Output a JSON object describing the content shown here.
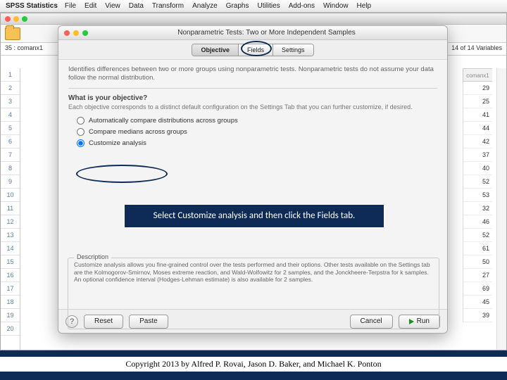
{
  "menubar": {
    "app": "SPSS Statistics",
    "items": [
      "File",
      "Edit",
      "View",
      "Data",
      "Transform",
      "Analyze",
      "Graphs",
      "Utilities",
      "Add-ons",
      "Window",
      "Help"
    ]
  },
  "datawin": {
    "cellref": "35 : comanx1",
    "varcount": "14 of 14 Variables",
    "colname": "comanx1",
    "rows": [
      "1",
      "2",
      "3",
      "4",
      "5",
      "6",
      "7",
      "8",
      "9",
      "10",
      "11",
      "12",
      "13",
      "14",
      "15",
      "16",
      "17",
      "18",
      "19",
      "20"
    ],
    "vals": [
      "29",
      "25",
      "41",
      "44",
      "42",
      "37",
      "40",
      "52",
      "53",
      "32",
      "46",
      "52",
      "61",
      "50",
      "27",
      "69",
      "45",
      "39",
      "",
      ""
    ]
  },
  "dialog": {
    "title": "Nonparametric Tests: Two or More Independent Samples",
    "tabs": {
      "objective": "Objective",
      "fields": "Fields",
      "settings": "Settings"
    },
    "intro": "Identifies differences between two or more groups using nonparametric tests. Nonparametric tests do not assume your data follow the normal distribution.",
    "qhead": "What is your objective?",
    "qsub": "Each objective corresponds to a distinct default configuration on the Settings Tab that you can further customize, if desired.",
    "opt1": "Automatically compare distributions across groups",
    "opt2": "Compare medians across groups",
    "opt3": "Customize analysis",
    "desc_legend": "Description",
    "desc_text": "Customize analysis allows you fine-grained control over the tests performed and their options. Other tests available on the Settings tab are the Kolmogorov-Smirnov, Moses extreme reaction, and Wald-Wolfowitz for 2 samples, and the Jonckheere-Terpstra for k samples. An optional confidence interval (Hodges-Lehman estimate) is also available for 2 samples.",
    "buttons": {
      "help": "?",
      "reset": "Reset",
      "paste": "Paste",
      "cancel": "Cancel",
      "run": "Run"
    }
  },
  "instruction": "Select Customize analysis and then click the Fields tab.",
  "copyright": "Copyright 2013 by Alfred P. Rovai, Jason D. Baker, and Michael K. Ponton"
}
